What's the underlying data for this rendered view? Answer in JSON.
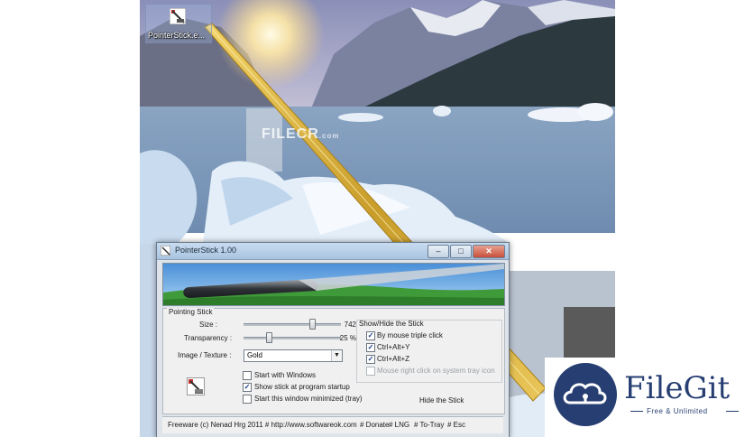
{
  "desktop": {
    "icon_label": "PointerStick.e...",
    "watermark_name": "FILECR",
    "watermark_suffix": ".com"
  },
  "window": {
    "title": "PointerStick 1.00",
    "title_buttons": {
      "minimize": "–",
      "maximize": "□",
      "close": "✕"
    },
    "section_title": "Pointing Stick",
    "size": {
      "label": "Size :",
      "value": "742",
      "level": 0.72
    },
    "transparency": {
      "label": "Transparency :",
      "value": "25 %",
      "level": 0.25
    },
    "texture": {
      "label": "Image / Texture :",
      "selected": "Gold"
    },
    "checkboxes": [
      {
        "label": "Start with Windows",
        "checked": false
      },
      {
        "label": "Show stick at program startup",
        "checked": true
      },
      {
        "label": "Start this window minimized (tray)",
        "checked": false
      }
    ],
    "show_hide": {
      "title": "Show/Hide the Stick",
      "options": [
        {
          "label": "By mouse triple click",
          "checked": true
        },
        {
          "label": "Ctrl+Alt+Y",
          "checked": true
        },
        {
          "label": "Ctrl+Alt+Z",
          "checked": true
        },
        {
          "label": "Mouse right click on system tray icon",
          "checked": false,
          "disabled": true
        }
      ]
    },
    "hide_button": "Hide the Stick",
    "statusbar": {
      "copyright": "Freeware (c) Nenad Hrg 2011 # http://www.softwareok.com",
      "links": [
        "# Donate",
        "# LNG",
        "# To-Tray",
        "# Esc"
      ]
    }
  },
  "logo": {
    "name": "FileGit",
    "tagline": "Free & Unlimited"
  },
  "colors": {
    "brand": "#273e72",
    "stick_gold": "#d9b43a"
  }
}
